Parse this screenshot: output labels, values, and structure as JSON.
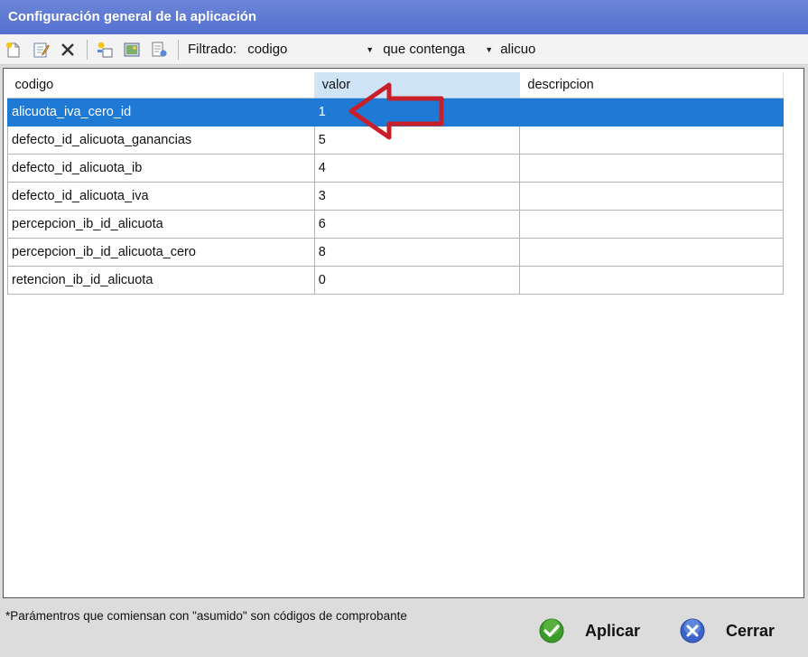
{
  "window": {
    "title": "Configuración general de la aplicación"
  },
  "toolbar": {
    "filter_label": "Filtrado:",
    "filter_field": "codigo",
    "filter_operator": "que contenga",
    "filter_value": "alicuo"
  },
  "grid": {
    "columns": [
      "codigo",
      "valor",
      "descripcion"
    ],
    "sorted_column": "valor",
    "selected_row": 0,
    "rows": [
      {
        "codigo": "alicuota_iva_cero_id",
        "valor": "1",
        "descripcion": ""
      },
      {
        "codigo": "defecto_id_alicuota_ganancias",
        "valor": "5",
        "descripcion": ""
      },
      {
        "codigo": "defecto_id_alicuota_ib",
        "valor": "4",
        "descripcion": ""
      },
      {
        "codigo": "defecto_id_alicuota_iva",
        "valor": "3",
        "descripcion": ""
      },
      {
        "codigo": "percepcion_ib_id_alicuota",
        "valor": "6",
        "descripcion": ""
      },
      {
        "codigo": "percepcion_ib_id_alicuota_cero",
        "valor": "8",
        "descripcion": ""
      },
      {
        "codigo": "retencion_ib_id_alicuota",
        "valor": "0",
        "descripcion": ""
      }
    ]
  },
  "footer": {
    "note": "*Parámentros que comiensan con \"asumido\" son códigos de comprobante",
    "apply_label": "Aplicar",
    "close_label": "Cerrar"
  },
  "colors": {
    "title_bar": "#5d78d3",
    "selection": "#1f7ad6",
    "annotation_arrow": "#c8202a"
  },
  "icons": [
    "new-icon",
    "edit-icon",
    "delete-icon",
    "add-item-icon",
    "image-icon",
    "export-icon",
    "checkmark-icon",
    "close-circle-icon",
    "arrow-annotation"
  ]
}
